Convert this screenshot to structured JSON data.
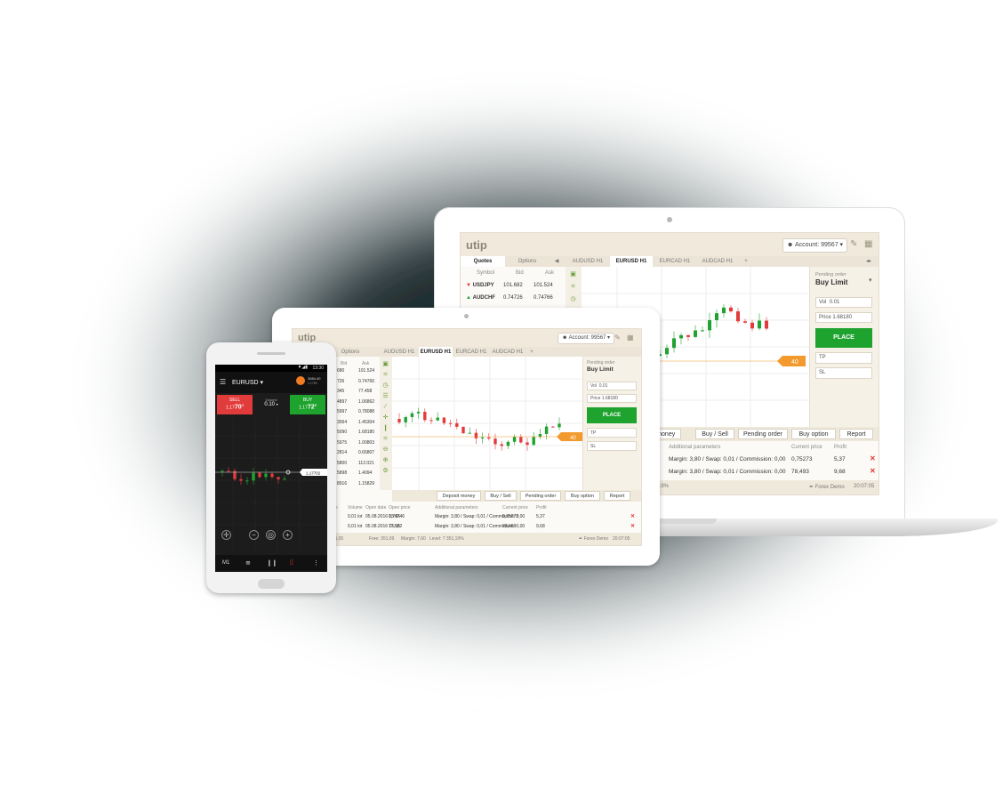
{
  "laptop": {
    "logo": "utip",
    "account": "Account: 99567",
    "quote_tabs": [
      "Quotes",
      "Options"
    ],
    "quote_headers": [
      "Symbol",
      "Bid",
      "Ask"
    ],
    "quotes": [
      {
        "symbol": "USDJPY",
        "bid": "101.682",
        "ask": "101.524",
        "dir": "down"
      },
      {
        "symbol": "AUDCHF",
        "bid": "0.74726",
        "ask": "0.74766",
        "dir": "up"
      }
    ],
    "chart_tabs": [
      "AUDUSD H1",
      "EURUSD H1",
      "EURCAD H1",
      "AUDCAD H1"
    ],
    "order": {
      "type_label": "Pending order",
      "type_value": "Buy Limit",
      "vol_label": "Vol",
      "vol_value": "0.01",
      "price_label": "Price",
      "price_value": "1.68180",
      "place": "PLACE",
      "tp": "TP",
      "sl": "SL"
    },
    "price_tag": "40",
    "toolbar": [
      "Deposit money",
      "Buy / Sell",
      "Pending order",
      "Buy option",
      "Report"
    ],
    "toolbar_visible": [
      "it money",
      "Buy / Sell",
      "Pending order",
      "Buy option",
      "Report"
    ],
    "table_headers": [
      "Additional parameters",
      "Current price",
      "Profit"
    ],
    "rows": [
      {
        "params": "Margin: 3,80 / Swap: 0,01 / Commission: 0,00",
        "price": "0,75273",
        "profit": "5,37"
      },
      {
        "params": "Margin: 3,80 / Swap: 0,01 / Commission: 0,00",
        "price": "78,493",
        "profit": "9,68"
      }
    ],
    "status_left": "19%",
    "status_right": "Forex Demo",
    "status_time": "20:07:05"
  },
  "tablet": {
    "logo": "utip",
    "account": "Account: 99567",
    "options_tab": "Options",
    "chart_tabs": [
      "AUDUSD H1",
      "EURUSD H1",
      "EURCAD H1",
      "AUDCAD H1"
    ],
    "quote_headers": [
      "Bid",
      "Ask"
    ],
    "quotes": [
      [
        "680",
        "101.524"
      ],
      [
        "726",
        "0.74766"
      ],
      [
        "345",
        "77.458"
      ],
      [
        "4897",
        "1.06862"
      ],
      [
        "5997",
        "0.78088"
      ],
      [
        "3064",
        "1.45304"
      ],
      [
        "5090",
        "1.68180"
      ],
      [
        "5975",
        "1.00803"
      ],
      [
        "2814",
        "0.66807"
      ],
      [
        "5800",
        "112.021"
      ],
      [
        "5898",
        "1.4094"
      ],
      [
        "8916",
        "1.15829"
      ]
    ],
    "order": {
      "type_label": "Pending order",
      "type_value": "Buy Limit",
      "vol_label": "Vol",
      "vol_value": "0.01",
      "price_label": "Price",
      "price_value": "1.68180",
      "place": "PLACE",
      "tp": "TP",
      "sl": "SL"
    },
    "price_tag": "40",
    "toolbar": [
      "Deposit money",
      "Buy / Sell",
      "Pending order",
      "Buy option",
      "Report"
    ],
    "table_headers": [
      "Type",
      "Volume",
      "Open date",
      "Open price",
      "Additional parameters",
      "Current price",
      "Profit"
    ],
    "rows": [
      {
        "type": "Buy",
        "volume": "0,01 lot",
        "date": "05.08.2016 15:55",
        "open": "0,74746",
        "params": "Margin: 3,80 / Swap: 0,01 / Commission: 0,00",
        "price": "0,75273",
        "profit": "5,37"
      },
      {
        "type": "Buy",
        "volume": "0,01 lot",
        "date": "05.08.2016 15:55",
        "open": "77,582",
        "params": "Margin: 3,80 / Swap: 0,01 / Commission: 0,00",
        "price": "78,493",
        "profit": "9,68"
      }
    ],
    "status": [
      "Equity: 15,05",
      "Free: 351,09",
      "Margin: 7,60",
      "Level: 7 351,19%"
    ],
    "status_right": "Forex Demo",
    "status_time": "20:07:05"
  },
  "phone": {
    "time": "13:30",
    "symbol": "EURUSD",
    "balance": "2684.40",
    "balance_sub": "1.1750",
    "sell_label": "SELL",
    "sell_price_prefix": "1.17",
    "sell_price_big": "70",
    "sell_price_sup": "4",
    "volume_label": "Volume",
    "volume_value": "0.10",
    "buy_label": "BUY",
    "buy_price_prefix": "1.17",
    "buy_price_big": "72",
    "buy_price_sup": "6",
    "price_tag": "1.17702",
    "timeframe": "M1"
  },
  "colors": {
    "accent_green": "#1ea32e",
    "sell_red": "#e23b3b",
    "price_orange": "#f29a2e",
    "ui_beige": "#f0e9dc"
  }
}
